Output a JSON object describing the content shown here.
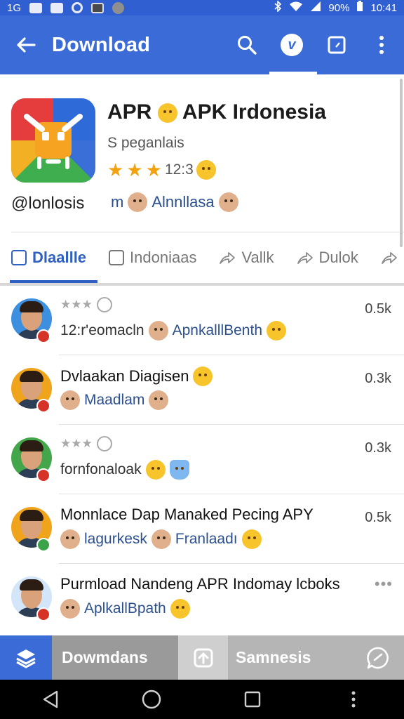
{
  "status_bar": {
    "left_text": "1G",
    "battery": "90%",
    "time": "10:41",
    "icons": [
      "image-icon",
      "card-icon",
      "circle-icon",
      "screen-icon",
      "gray-dot-icon",
      "bluetooth-icon",
      "wifi-icon",
      "signal-icon",
      "battery-icon"
    ]
  },
  "app_bar": {
    "title": "Download",
    "actions": [
      "search-icon",
      "v-badge-icon",
      "square-icon",
      "more-vert-icon"
    ],
    "v_badge": "v"
  },
  "app": {
    "name": "APR 😫 APK Irdonesia",
    "name_text": "APR",
    "name_text2": "APK Irdonesia",
    "subtitle": "S peganlais",
    "rating_value": "12:3",
    "stars": 3,
    "handle": "@lonlosis",
    "mention_prefix": "m",
    "mention_text": "Alnnllasa"
  },
  "tabs": [
    {
      "label": "Dlaallle",
      "icon": "grid-icon"
    },
    {
      "label": "Indoniaas",
      "icon": "copy-icon"
    },
    {
      "label": "Vallk",
      "icon": "share-icon"
    },
    {
      "label": "Dulok",
      "icon": "share-icon"
    }
  ],
  "comments": [
    {
      "line1": "",
      "stars": "★★★",
      "line2_a": "12:r'eomacln",
      "line2_b": "ApnkalllBenth",
      "count": "0.5k"
    },
    {
      "line1": "Dvlaakan Diagisen",
      "line2_b": "Maadlam",
      "count": "0.3k"
    },
    {
      "line1": "",
      "stars": "★★★",
      "line2_a": "fornfonaloak",
      "count": "0.3k"
    },
    {
      "line1": "Monnlace Dap Manaked Pecing APY",
      "line2_b": "lagurkesk",
      "line2_c": "Franlaadı",
      "count": "0.5k"
    },
    {
      "line1": "Purmload Nandeng APR Indomay lcboks",
      "line2_b": "AplkallBpath",
      "count": "•••"
    }
  ],
  "bottom_bar": {
    "download_label": "Dowmdans",
    "samnesis_label": "Samnesis"
  },
  "colors": {
    "primary": "#3a6bd6",
    "star": "#f3a20f",
    "link": "#2b4f8f"
  }
}
